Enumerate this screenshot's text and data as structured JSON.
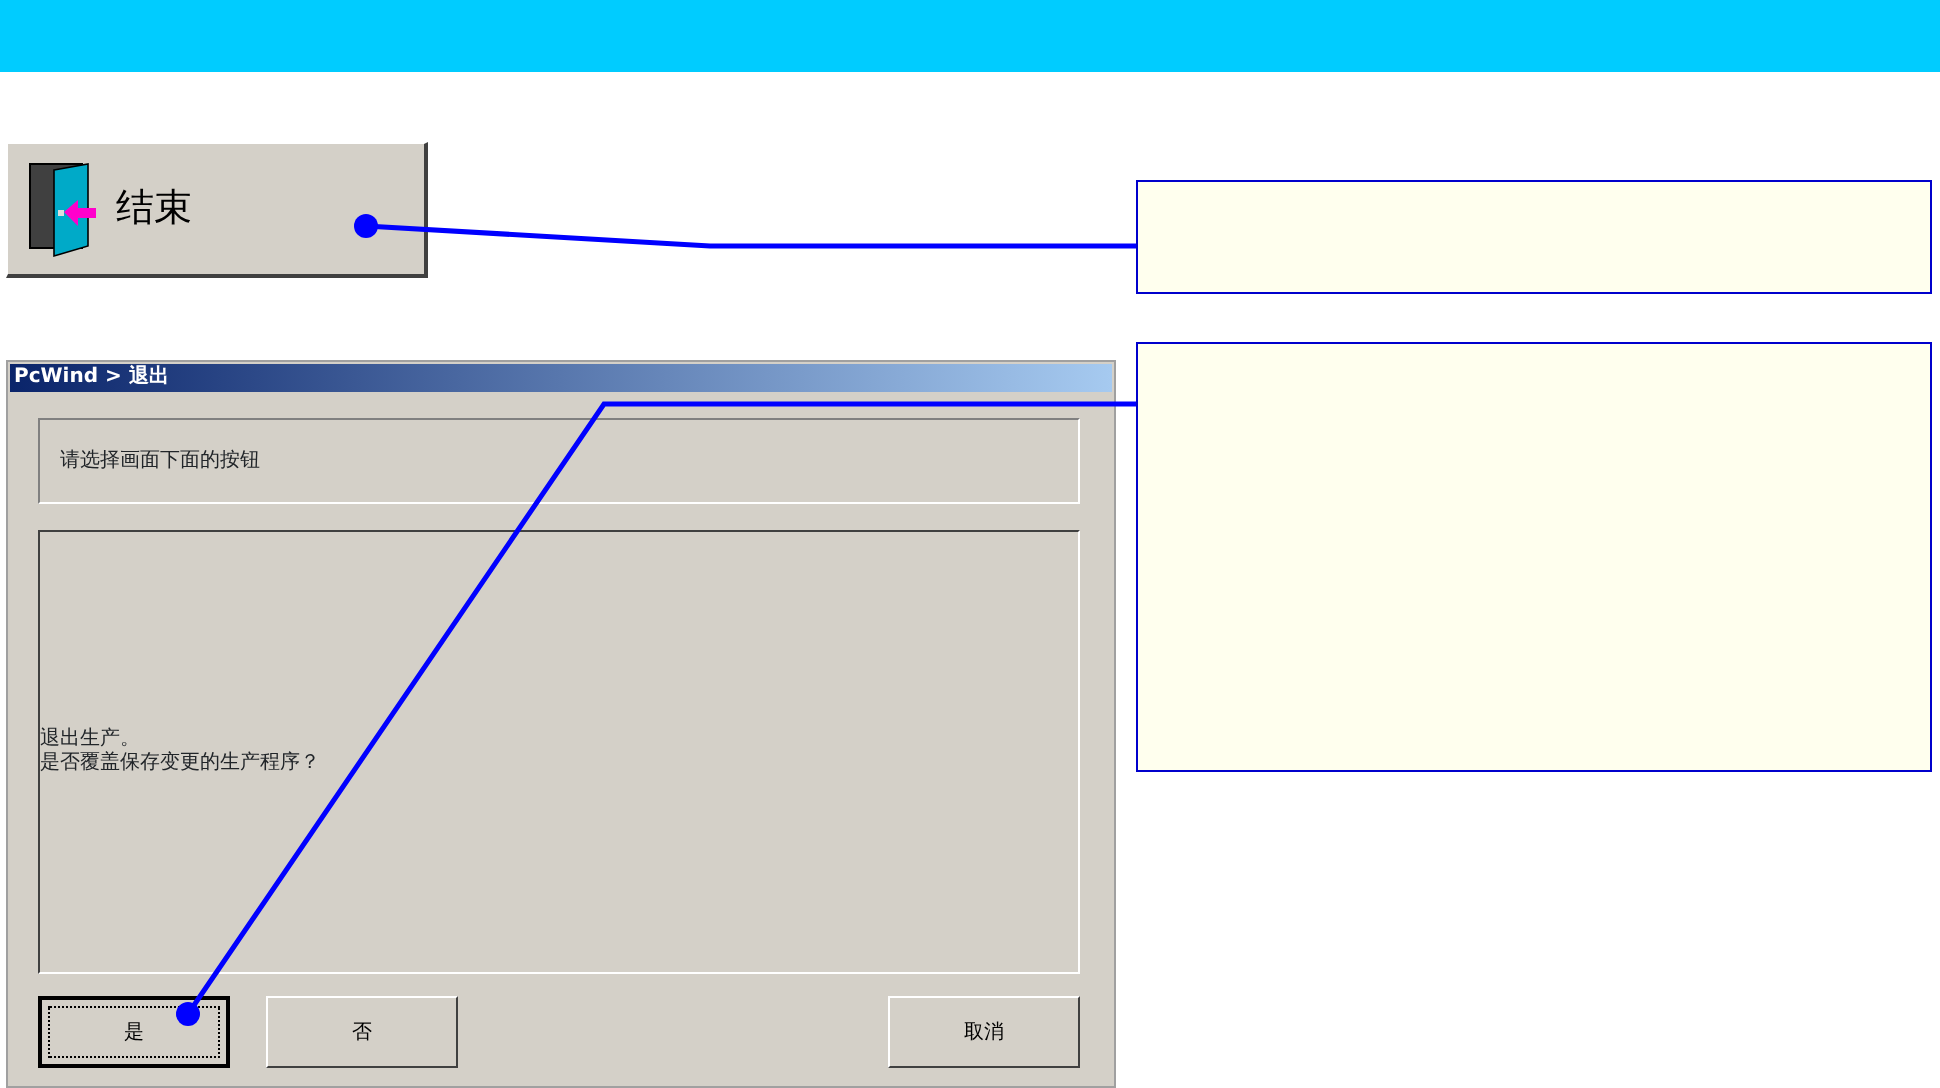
{
  "end_button": {
    "label": "结束"
  },
  "dialog": {
    "title": "PcWind > 退出",
    "instruction": "请选择画面下面的按钮",
    "message_lines": [
      "退出生产。",
      "是否覆盖保存变更的生产程序？"
    ],
    "buttons": [
      {
        "label": "是",
        "focused": true
      },
      {
        "label": "否",
        "focused": false
      },
      {
        "label": "取消",
        "focused": false
      }
    ]
  }
}
